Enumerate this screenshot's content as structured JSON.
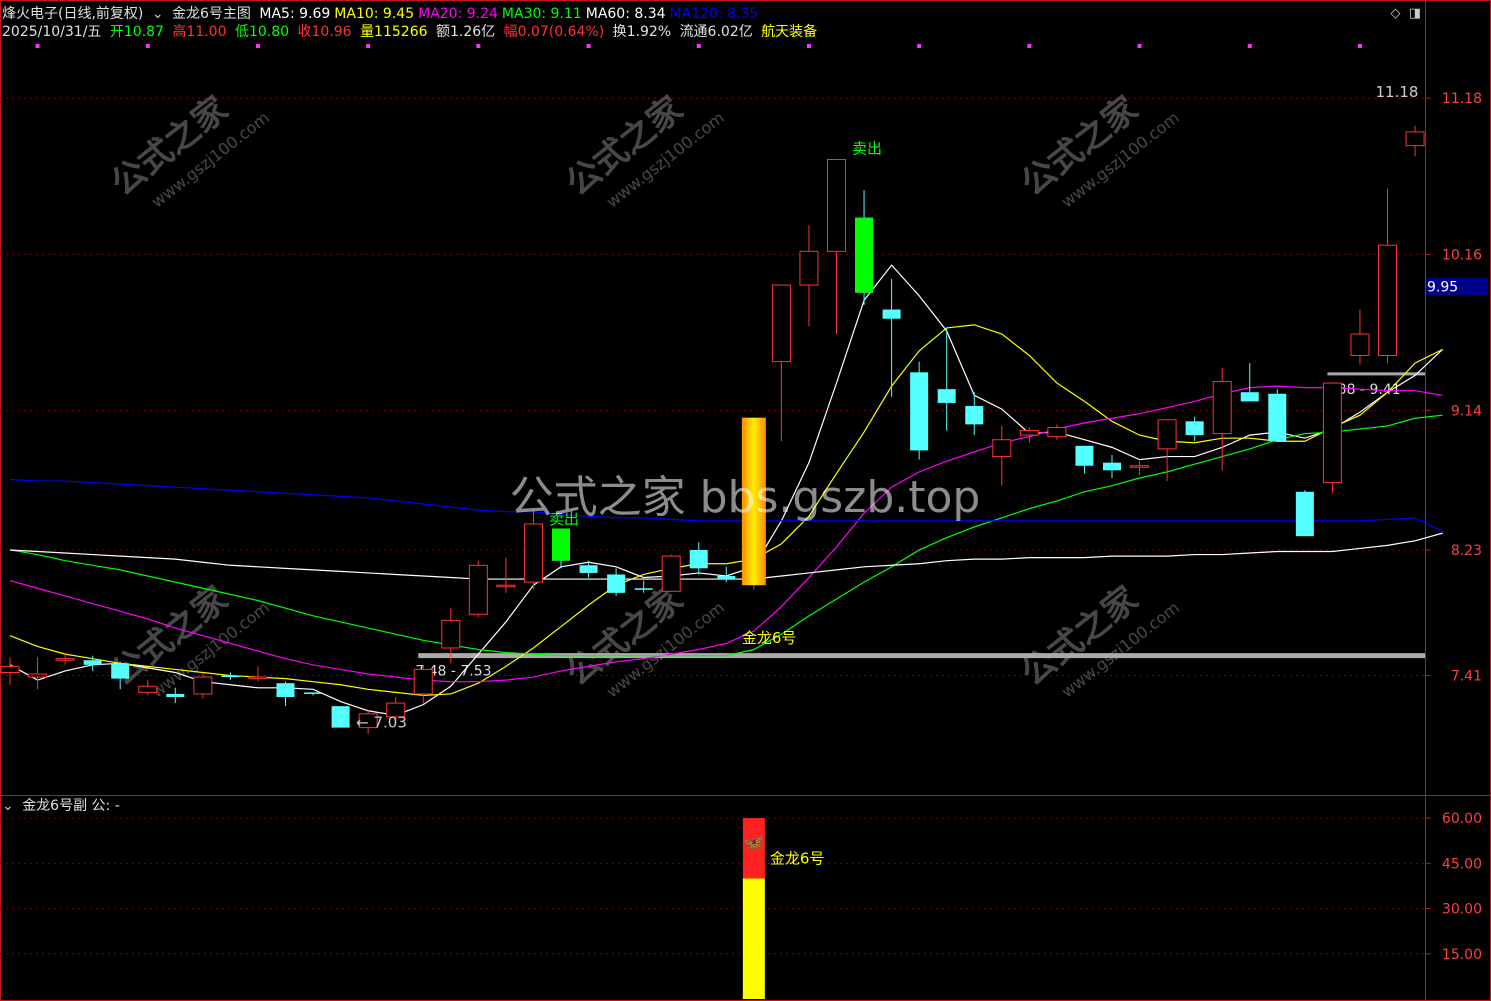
{
  "header": {
    "stock": "烽火电子(日线,前复权)",
    "indicator": "金龙6号主图",
    "ma": [
      {
        "label": "MA5: 9.69",
        "color": "#ffffff"
      },
      {
        "label": "MA10: 9.45",
        "color": "#ffff00"
      },
      {
        "label": "MA20: 9.24",
        "color": "#ff00ff"
      },
      {
        "label": "MA30: 9.11",
        "color": "#00ff00"
      },
      {
        "label": "MA60: 8.34",
        "color": "#ffffff"
      },
      {
        "label": "MA120: 8.35",
        "color": "#0000ff"
      }
    ],
    "date": "2025/10/31/五",
    "open": "开10.87",
    "high": "高11.00",
    "low": "低10.80",
    "close": "收10.96",
    "volume": "量115266",
    "amount": "额1.26亿",
    "change": "幅0.07(0.64%)",
    "turnover": "换1.92%",
    "float_cap": "流通6.02亿",
    "sector": "航天装备"
  },
  "sub_panel": {
    "title": "金龙6号副 公: -"
  },
  "watermarks": {
    "center": "公式之家 bbs.gszb.top",
    "tile_cn": "公式之家",
    "tile_url": "www.gszj100.com"
  },
  "colors": {
    "up": "#ff3232",
    "down": "#54ffff",
    "grid": "#800000",
    "axis": "#c01818"
  },
  "chart_data": [
    {
      "type": "candlestick",
      "title": "金龙6号主图",
      "y_ticks": [
        7.41,
        8.23,
        9.14,
        10.16,
        11.18
      ],
      "ylim": [
        6.63,
        11.56
      ],
      "price_tag": 9.95,
      "candles": [
        {
          "o": 7.43,
          "h": 7.53,
          "l": 7.35,
          "c": 7.47
        },
        {
          "o": 7.4,
          "h": 7.53,
          "l": 7.32,
          "c": 7.42
        },
        {
          "o": 7.51,
          "h": 7.56,
          "l": 7.48,
          "c": 7.52
        },
        {
          "o": 7.51,
          "h": 7.54,
          "l": 7.44,
          "c": 7.48
        },
        {
          "o": 7.49,
          "h": 7.5,
          "l": 7.32,
          "c": 7.39
        },
        {
          "o": 7.3,
          "h": 7.38,
          "l": 7.28,
          "c": 7.34
        },
        {
          "o": 7.29,
          "h": 7.33,
          "l": 7.23,
          "c": 7.27
        },
        {
          "o": 7.29,
          "h": 7.43,
          "l": 7.26,
          "c": 7.4
        },
        {
          "o": 7.41,
          "h": 7.43,
          "l": 7.38,
          "c": 7.4
        },
        {
          "o": 7.39,
          "h": 7.47,
          "l": 7.37,
          "c": 7.4
        },
        {
          "o": 7.36,
          "h": 7.37,
          "l": 7.21,
          "c": 7.27
        },
        {
          "o": 7.3,
          "h": 7.3,
          "l": 7.28,
          "c": 7.29
        },
        {
          "o": 7.21,
          "h": 7.21,
          "l": 7.07,
          "c": 7.07
        },
        {
          "o": 7.07,
          "h": 7.18,
          "l": 7.03,
          "c": 7.16
        },
        {
          "o": 7.14,
          "h": 7.27,
          "l": 7.11,
          "c": 7.23
        },
        {
          "o": 7.29,
          "h": 7.48,
          "l": 7.23,
          "c": 7.45
        },
        {
          "o": 7.59,
          "h": 7.85,
          "l": 7.49,
          "c": 7.77
        },
        {
          "o": 7.81,
          "h": 8.16,
          "l": 7.79,
          "c": 8.13
        },
        {
          "o": 8.0,
          "h": 8.18,
          "l": 7.95,
          "c": 8.0
        },
        {
          "o": 8.02,
          "h": 8.49,
          "l": 7.97,
          "c": 8.4
        },
        {
          "o": 8.37,
          "h": 8.37,
          "l": 8.11,
          "c": 8.16
        },
        {
          "o": 8.13,
          "h": 8.16,
          "l": 8.05,
          "c": 8.08
        },
        {
          "o": 8.07,
          "h": 8.11,
          "l": 7.93,
          "c": 7.95
        },
        {
          "o": 7.98,
          "h": 8.03,
          "l": 7.95,
          "c": 7.97
        },
        {
          "o": 7.96,
          "h": 8.2,
          "l": 7.96,
          "c": 8.19
        },
        {
          "o": 8.23,
          "h": 8.28,
          "l": 8.07,
          "c": 8.11
        },
        {
          "o": 8.06,
          "h": 8.12,
          "l": 8.02,
          "c": 8.04
        },
        {
          "o": 8.02,
          "h": 8.8,
          "l": 7.97,
          "c": 8.8
        },
        {
          "o": 9.46,
          "h": 9.69,
          "l": 8.94,
          "c": 9.96
        },
        {
          "o": 9.96,
          "h": 10.35,
          "l": 9.69,
          "c": 10.18
        },
        {
          "o": 10.18,
          "h": 10.78,
          "l": 9.64,
          "c": 10.78
        },
        {
          "o": 10.4,
          "h": 10.58,
          "l": 9.83,
          "c": 9.91
        },
        {
          "o": 9.8,
          "h": 10.0,
          "l": 9.23,
          "c": 9.74
        },
        {
          "o": 9.39,
          "h": 9.46,
          "l": 8.82,
          "c": 8.88
        },
        {
          "o": 9.28,
          "h": 9.68,
          "l": 9.01,
          "c": 9.19
        },
        {
          "o": 9.17,
          "h": 9.26,
          "l": 8.98,
          "c": 9.05
        },
        {
          "o": 8.84,
          "h": 9.04,
          "l": 8.65,
          "c": 8.95
        },
        {
          "o": 8.98,
          "h": 9.03,
          "l": 8.93,
          "c": 9.01
        },
        {
          "o": 8.97,
          "h": 9.05,
          "l": 8.95,
          "c": 9.03
        },
        {
          "o": 8.91,
          "h": 8.91,
          "l": 8.73,
          "c": 8.78
        },
        {
          "o": 8.8,
          "h": 8.85,
          "l": 8.7,
          "c": 8.75
        },
        {
          "o": 8.77,
          "h": 8.81,
          "l": 8.72,
          "c": 8.78
        },
        {
          "o": 8.89,
          "h": 9.04,
          "l": 8.68,
          "c": 9.08
        },
        {
          "o": 9.07,
          "h": 9.1,
          "l": 8.94,
          "c": 8.98
        },
        {
          "o": 8.99,
          "h": 9.42,
          "l": 8.75,
          "c": 9.33
        },
        {
          "o": 9.26,
          "h": 9.45,
          "l": 9.21,
          "c": 9.2
        },
        {
          "o": 9.25,
          "h": 9.28,
          "l": 8.95,
          "c": 8.94
        },
        {
          "o": 8.61,
          "h": 8.62,
          "l": 8.32,
          "c": 8.32
        },
        {
          "o": 8.67,
          "h": 9.32,
          "l": 8.6,
          "c": 9.32
        },
        {
          "o": 9.5,
          "h": 9.8,
          "l": 9.44,
          "c": 9.64
        },
        {
          "o": 9.5,
          "h": 10.59,
          "l": 9.45,
          "c": 10.22
        },
        {
          "o": 10.87,
          "h": 11.0,
          "l": 10.8,
          "c": 10.96
        }
      ],
      "ma_lines": [
        {
          "name": "MA5",
          "color": "#ffffff",
          "values": [
            7.48,
            7.38,
            7.44,
            7.48,
            7.49,
            7.46,
            7.43,
            7.37,
            7.35,
            7.33,
            7.33,
            7.32,
            7.24,
            7.18,
            7.15,
            7.22,
            7.34,
            7.55,
            7.76,
            8.0,
            8.12,
            8.15,
            8.12,
            8.05,
            8.06,
            8.08,
            8.06,
            8.12,
            8.42,
            8.8,
            9.32,
            9.86,
            10.09,
            9.89,
            9.66,
            9.24,
            9.15,
            8.99,
            9.0,
            8.95,
            8.9,
            8.82,
            8.84,
            8.84,
            8.9,
            8.98,
            9.0,
            8.96,
            9.02,
            9.13,
            9.26,
            9.37,
            9.54
          ]
        },
        {
          "name": "MA10",
          "color": "#ffff00",
          "values": [
            7.67,
            7.6,
            7.55,
            7.52,
            7.49,
            7.47,
            7.45,
            7.43,
            7.41,
            7.4,
            7.39,
            7.37,
            7.35,
            7.32,
            7.3,
            7.28,
            7.29,
            7.36,
            7.47,
            7.59,
            7.73,
            7.87,
            8.0,
            8.07,
            8.11,
            8.14,
            8.14,
            8.17,
            8.27,
            8.45,
            8.73,
            9.0,
            9.3,
            9.53,
            9.68,
            9.7,
            9.64,
            9.5,
            9.32,
            9.2,
            9.07,
            8.98,
            8.94,
            8.93,
            8.96,
            8.96,
            8.94,
            8.94,
            9.03,
            9.11,
            9.26,
            9.45,
            9.54
          ]
        },
        {
          "name": "MA20",
          "color": "#ff00ff",
          "values": [
            8.03,
            7.98,
            7.93,
            7.88,
            7.83,
            7.78,
            7.72,
            7.67,
            7.62,
            7.57,
            7.52,
            7.48,
            7.45,
            7.42,
            7.4,
            7.38,
            7.37,
            7.37,
            7.38,
            7.4,
            7.44,
            7.47,
            7.5,
            7.52,
            7.55,
            7.58,
            7.62,
            7.7,
            7.86,
            8.05,
            8.25,
            8.47,
            8.64,
            8.74,
            8.81,
            8.87,
            8.93,
            8.97,
            9.02,
            9.06,
            9.09,
            9.12,
            9.16,
            9.2,
            9.25,
            9.29,
            9.3,
            9.29,
            9.29,
            9.28,
            9.27,
            9.27,
            9.24
          ]
        },
        {
          "name": "MA30",
          "color": "#00ff00",
          "values": [
            8.23,
            8.2,
            8.16,
            8.13,
            8.1,
            8.06,
            8.02,
            7.98,
            7.94,
            7.9,
            7.85,
            7.8,
            7.76,
            7.72,
            7.68,
            7.64,
            7.61,
            7.58,
            7.56,
            7.55,
            7.54,
            7.54,
            7.54,
            7.54,
            7.54,
            7.54,
            7.54,
            7.58,
            7.68,
            7.8,
            7.91,
            8.02,
            8.12,
            8.23,
            8.31,
            8.38,
            8.44,
            8.5,
            8.55,
            8.61,
            8.65,
            8.7,
            8.74,
            8.79,
            8.84,
            8.89,
            8.95,
            8.99,
            9.0,
            9.02,
            9.04,
            9.09,
            9.11
          ]
        },
        {
          "name": "MA60",
          "color": "#ffffff",
          "values": [
            8.23,
            8.22,
            8.21,
            8.2,
            8.19,
            8.18,
            8.17,
            8.15,
            8.13,
            8.12,
            8.11,
            8.1,
            8.09,
            8.08,
            8.07,
            8.06,
            8.05,
            8.04,
            8.04,
            8.04,
            8.04,
            8.04,
            8.04,
            8.04,
            8.04,
            8.04,
            8.04,
            8.04,
            8.06,
            8.08,
            8.1,
            8.12,
            8.13,
            8.14,
            8.16,
            8.17,
            8.17,
            8.18,
            8.18,
            8.18,
            8.19,
            8.19,
            8.19,
            8.2,
            8.2,
            8.21,
            8.22,
            8.22,
            8.22,
            8.24,
            8.26,
            8.29,
            8.34
          ]
        },
        {
          "name": "MA120",
          "color": "#0000ff",
          "values": [
            8.69,
            8.68,
            8.68,
            8.67,
            8.66,
            8.65,
            8.64,
            8.63,
            8.62,
            8.61,
            8.6,
            8.59,
            8.58,
            8.57,
            8.55,
            8.53,
            8.51,
            8.49,
            8.48,
            8.48,
            8.46,
            8.45,
            8.44,
            8.44,
            8.43,
            8.42,
            8.42,
            8.42,
            8.42,
            8.42,
            8.42,
            8.42,
            8.42,
            8.42,
            8.42,
            8.42,
            8.42,
            8.42,
            8.42,
            8.42,
            8.42,
            8.42,
            8.42,
            8.42,
            8.42,
            8.42,
            8.42,
            8.42,
            8.42,
            8.42,
            8.43,
            8.44,
            8.35
          ]
        }
      ],
      "support_lines": [
        {
          "price": 7.54,
          "from": 15,
          "to": 52,
          "label": "7.48 - 7.53"
        },
        {
          "price": 9.38,
          "from": 48,
          "to": 52,
          "label": "9.38 - 9.41"
        }
      ],
      "annotations": [
        {
          "text": "卖出",
          "index": 20,
          "price": 8.36,
          "color": "#00ff00"
        },
        {
          "text": "卖出",
          "index": 31,
          "price": 10.78,
          "color": "#00ff00"
        },
        {
          "text": "金龙6号",
          "index": 27,
          "price": 7.74,
          "color": "#ffff00"
        },
        {
          "text": "← 7.03",
          "index": 13,
          "price": 7.03,
          "color": "#cccccc"
        },
        {
          "text": "11.18",
          "index": 50,
          "price": 11.15,
          "color": "#cccccc"
        }
      ],
      "signal_bar": {
        "index": 27,
        "top": 8.8,
        "bottom": 8.0
      }
    },
    {
      "type": "bar",
      "title": "金龙6号副",
      "y_ticks": [
        15.0,
        30.0,
        45.0,
        60.0
      ],
      "ylim": [
        0,
        66
      ],
      "bars": [
        {
          "index": 27,
          "value": 40,
          "color": "#ffff00"
        },
        {
          "index": 27,
          "from": 40,
          "value": 60,
          "color": "#ff2020"
        }
      ],
      "label": {
        "text": "金龙6号",
        "index": 27,
        "value": 47,
        "color": "#ffff00"
      }
    }
  ]
}
